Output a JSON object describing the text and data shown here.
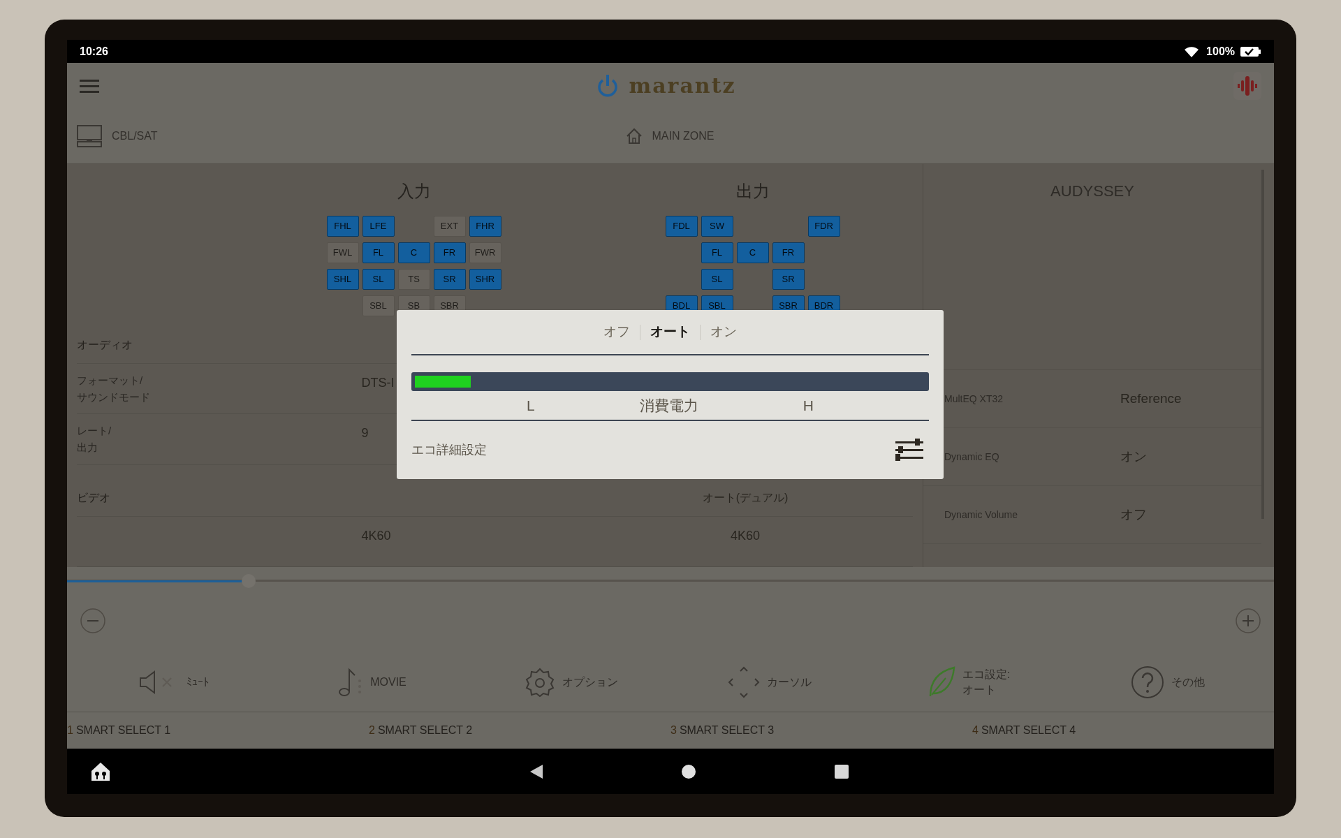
{
  "status_bar": {
    "time": "10:26",
    "battery": "100%"
  },
  "header": {
    "brand": "marantz"
  },
  "zone_bar": {
    "source": "CBL/SAT",
    "zone": "MAIN ZONE"
  },
  "input": {
    "title": "入力",
    "rows": [
      [
        {
          "label": "FHL",
          "on": true
        },
        {
          "label": "LFE",
          "on": true
        },
        {
          "kind": "empty"
        },
        {
          "label": "EXT",
          "on": false
        },
        {
          "label": "FHR",
          "on": true
        }
      ],
      [
        {
          "label": "FWL",
          "on": false
        },
        {
          "label": "FL",
          "on": true
        },
        {
          "label": "C",
          "on": true
        },
        {
          "label": "FR",
          "on": true
        },
        {
          "label": "FWR",
          "on": false
        }
      ],
      [
        {
          "label": "SHL",
          "on": true
        },
        {
          "label": "SL",
          "on": true
        },
        {
          "label": "TS",
          "on": false
        },
        {
          "label": "SR",
          "on": true
        },
        {
          "label": "SHR",
          "on": true
        }
      ],
      [
        {
          "kind": "empty"
        },
        {
          "label": "SBL",
          "on": false
        },
        {
          "label": "SB",
          "on": false
        },
        {
          "label": "SBR",
          "on": false
        },
        {
          "kind": "empty"
        }
      ]
    ]
  },
  "output": {
    "title": "出力",
    "rows": [
      [
        {
          "label": "FDL",
          "on": true
        },
        {
          "label": "SW",
          "on": true
        },
        {
          "kind": "empty"
        },
        {
          "kind": "empty"
        },
        {
          "label": "FDR",
          "on": true
        }
      ],
      [
        {
          "kind": "empty"
        },
        {
          "label": "FL",
          "on": true
        },
        {
          "label": "C",
          "on": true
        },
        {
          "label": "FR",
          "on": true
        },
        {
          "kind": "empty"
        }
      ],
      [
        {
          "kind": "empty"
        },
        {
          "label": "SL",
          "on": true
        },
        {
          "kind": "empty"
        },
        {
          "label": "SR",
          "on": true
        },
        {
          "kind": "empty"
        }
      ],
      [
        {
          "label": "BDL",
          "on": true
        },
        {
          "label": "SBL",
          "on": true
        },
        {
          "kind": "empty"
        },
        {
          "label": "SBR",
          "on": true
        },
        {
          "label": "BDR",
          "on": true
        }
      ]
    ]
  },
  "info_rows": [
    {
      "kind": "section",
      "label": "オーディオ"
    },
    {
      "kind": "row",
      "label": "フォーマット/\nサウンドモード",
      "input_value": "DTS-I"
    },
    {
      "kind": "row",
      "label": "レート/\n出力",
      "input_value": "9"
    },
    {
      "kind": "section",
      "label": "ビデオ",
      "output_value": "オート(デュアル)"
    },
    {
      "kind": "row",
      "input_value": "4K60",
      "output_value": "4K60"
    }
  ],
  "audyssey": {
    "title": "AUDYSSEY",
    "rows": [
      {
        "label": "MultEQ XT32",
        "value": "Reference"
      },
      {
        "label": "Dynamic EQ",
        "value": "オン"
      },
      {
        "label": "Dynamic Volume",
        "value": "オフ"
      }
    ]
  },
  "volume": {
    "level": 0.147
  },
  "actions": [
    {
      "kind": "mute",
      "label": "ﾐｭｰﾄ"
    },
    {
      "kind": "movie",
      "label": "MOVIE"
    },
    {
      "kind": "option",
      "label": "オプション"
    },
    {
      "kind": "cursor",
      "label": "カーソル"
    },
    {
      "kind": "eco",
      "label": "エコ設定:\nオート"
    },
    {
      "kind": "help",
      "label": "その他"
    }
  ],
  "smart_select": [
    {
      "number": "1",
      "label": "SMART SELECT 1"
    },
    {
      "number": "2",
      "label": "SMART SELECT 2"
    },
    {
      "number": "3",
      "label": "SMART SELECT 3"
    },
    {
      "number": "4",
      "label": "SMART SELECT 4"
    }
  ],
  "eco_dialog": {
    "tabs": [
      {
        "label": "オフ",
        "selected": false
      },
      {
        "label": "オート",
        "selected": true
      },
      {
        "label": "オン",
        "selected": false
      }
    ],
    "meter": {
      "level": 0.11,
      "low": "L",
      "caption": "消費電力",
      "high": "H"
    },
    "detail": "エコ詳細設定"
  }
}
